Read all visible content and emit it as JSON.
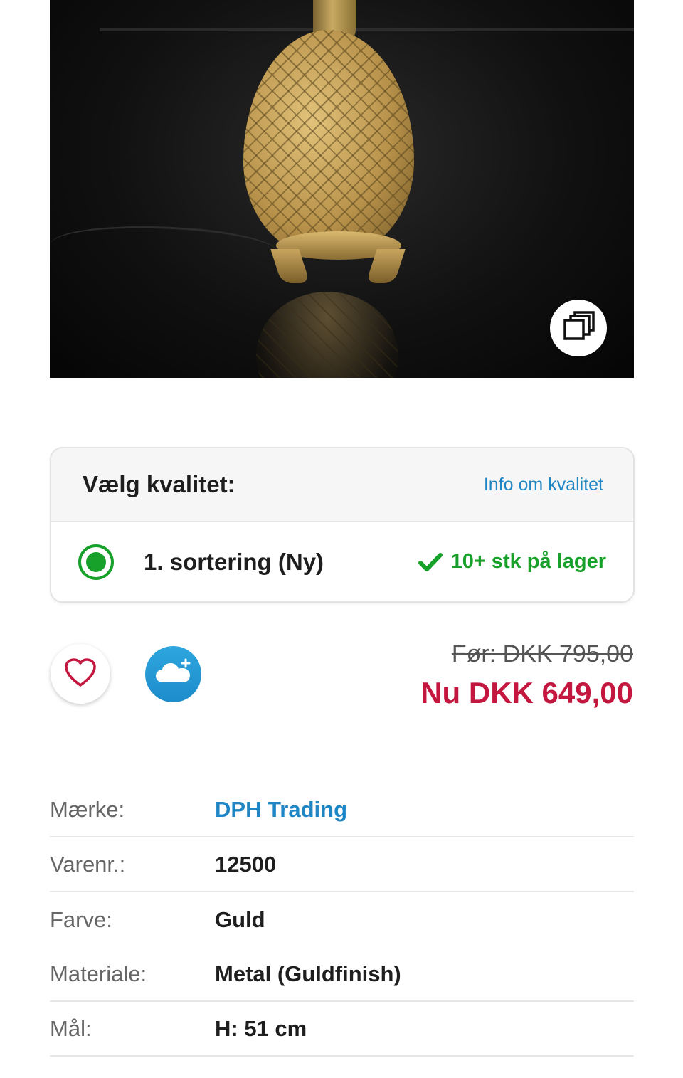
{
  "quality": {
    "title": "Vælg kvalitet:",
    "info_link": "Info om kvalitet",
    "option_label": "1. sortering (Ny)",
    "option_selected": true,
    "stock_text": "10+ stk på lager"
  },
  "price": {
    "old": "Før: DKK 795,00",
    "now": "Nu DKK 649,00"
  },
  "specs": [
    {
      "label": "Mærke:",
      "value": "DPH Trading",
      "is_link": true
    },
    {
      "label": "Varenr.:",
      "value": "12500",
      "is_link": false
    },
    {
      "label": "Farve:",
      "value": "Guld",
      "is_link": false
    },
    {
      "label": "Materiale:",
      "value": "Metal (Guldfinish)",
      "is_link": false
    },
    {
      "label": "Mål:",
      "value": "H: 51 cm",
      "is_link": false
    }
  ],
  "icons": {
    "gallery": "gallery-copy-icon",
    "wishlist": "heart-icon",
    "cloud": "cloud-plus-icon",
    "check": "check-icon"
  },
  "colors": {
    "accent_blue": "#1f86c6",
    "stock_green": "#17a02a",
    "price_red": "#c4173f",
    "heart_pink": "#c4173f"
  }
}
